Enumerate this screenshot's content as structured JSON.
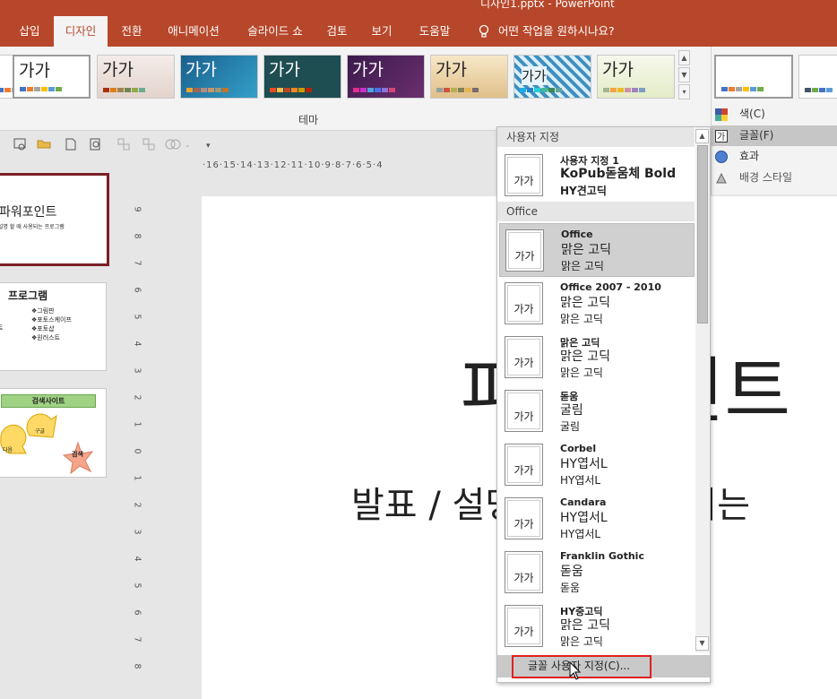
{
  "title": "디자인1.pptx  -  PowerPoint",
  "tabs": [
    "삽입",
    "디자인",
    "전환",
    "애니메이션",
    "슬라이드 쇼",
    "검토",
    "보기",
    "도움말"
  ],
  "tell_me": "어떤 작업을 원하시나요?",
  "themes_label": "테마",
  "theme_text": "가가",
  "variants": [
    {
      "label": "색(C)"
    },
    {
      "label": "글꼴(F)"
    },
    {
      "label": "효과"
    },
    {
      "label": "배경 스타일"
    }
  ],
  "ruler_top": "·16·15·14·13·12·11·10·9·8·7·6·5·4",
  "ruler_left": [
    "9",
    "8",
    "7",
    "6",
    "5",
    "4",
    "3",
    "2",
    "1",
    "0",
    "1",
    "2",
    "3",
    "4",
    "5",
    "6",
    "7",
    "8"
  ],
  "thumbs": {
    "s1_title": "파워포인트",
    "s1_sub": "발표 / 설명 할 때 사용되는 프로그램",
    "s2_title": "프로그램",
    "s2_items": [
      "그림판",
      "포토스케이프",
      "포토샵",
      "원러스트"
    ],
    "s2_left": "트",
    "s3_title": "검색사이트",
    "s3_a": "구글",
    "s3_b": "다음",
    "s3_c": "검색"
  },
  "slide": {
    "title_frag": "파워포인트",
    "sub_frag": "발표 / 설명 할 때 사용되는"
  },
  "dropdown": {
    "custom_header": "사용자 지정",
    "office_header": "Office",
    "preview": "가가",
    "custom_fonts": [
      {
        "name": "사용자 지정 1",
        "heading": "KoPub돋움체 Bold",
        "body": "HY견고딕"
      }
    ],
    "office_fonts": [
      {
        "name": "Office",
        "heading": "맑은 고딕",
        "body": "맑은 고딕"
      },
      {
        "name": "Office 2007 - 2010",
        "heading": "맑은 고딕",
        "body": "맑은 고딕"
      },
      {
        "name": "맑은 고딕",
        "heading": "맑은 고딕",
        "body": "맑은 고딕"
      },
      {
        "name": "돋움",
        "heading": "굴림",
        "body": "굴림"
      },
      {
        "name": "Corbel",
        "heading": "HY엽서L",
        "body": "HY엽서L"
      },
      {
        "name": "Candara",
        "heading": "HY엽서L",
        "body": "HY엽서L"
      },
      {
        "name": "Franklin Gothic",
        "heading": "돋움",
        "body": "돋움"
      },
      {
        "name": "HY중고딕",
        "heading": "맑은 고딕",
        "body": "맑은 고딕"
      }
    ],
    "customize": "글꼴 사용자 지정(C)..."
  }
}
